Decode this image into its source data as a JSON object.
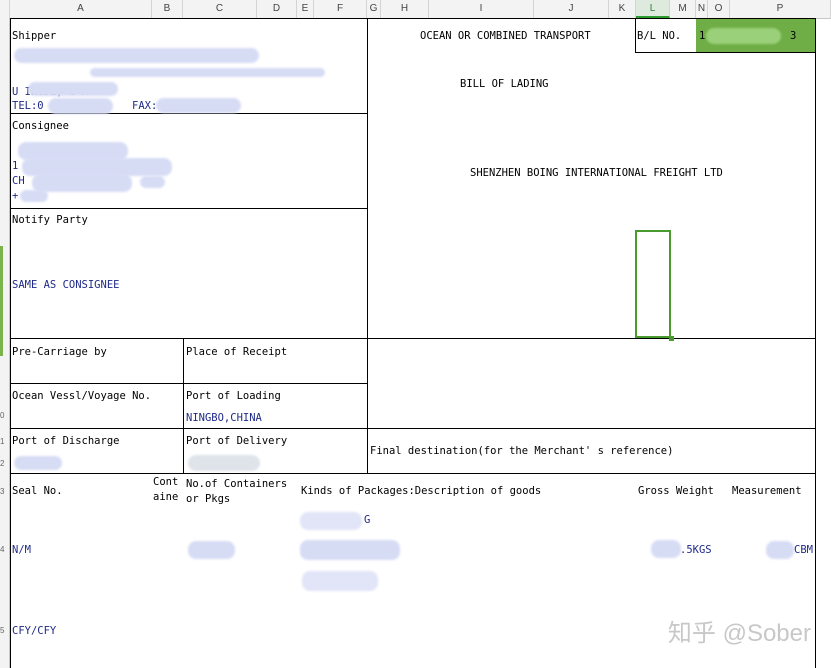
{
  "columns": [
    "A",
    "B",
    "C",
    "D",
    "E",
    "F",
    "G",
    "H",
    "I",
    "J",
    "K",
    "L",
    "M",
    "N",
    "O",
    "P"
  ],
  "selected_column": "L",
  "row_numbers": [
    "0",
    "1",
    "2",
    "3",
    "4",
    "5"
  ],
  "shipper": {
    "label": "Shipper",
    "line2": "U                      INGDE, C    A",
    "tel_label": "TEL:0",
    "fax_label": "FAX:"
  },
  "consignee": {
    "label": "Consignee",
    "line1": "1",
    "line2": "CH",
    "line3": "+"
  },
  "notify": {
    "label": "Notify Party",
    "value": "SAME AS CONSIGNEE"
  },
  "header": {
    "transport": "OCEAN OR COMBINED TRANSPORT",
    "bol_label": "B/L NO.",
    "bol_value": "1",
    "bol_suffix": "3",
    "bill": "BILL OF LADING",
    "company": "SHENZHEN BOING INTERNATIONAL FREIGHT LTD"
  },
  "pre_carriage": {
    "label": "Pre-Carriage by"
  },
  "place_receipt": {
    "label": "Place of Receipt"
  },
  "vessel": {
    "label": "Ocean Vessl/Voyage No."
  },
  "port_loading": {
    "label": "Port of Loading",
    "value": "NINGBO,CHINA"
  },
  "port_discharge": {
    "label": "Port of Discharge"
  },
  "port_delivery": {
    "label": "Port of Delivery"
  },
  "final_dest": {
    "label": "Final destination(for the Merchant' s reference)"
  },
  "goods_header": {
    "seal": "Seal No.",
    "cont1": "Cont",
    "cont2": "aine",
    "containers1": "No.of Containers",
    "containers2": "or Pkgs",
    "kinds": "Kinds of Packages:Description of goods",
    "gross": "Gross Weight",
    "measure": "Measurement"
  },
  "goods": {
    "marks": "N/M",
    "desc_suffix": "G",
    "weight_suffix": ".5KGS",
    "measure_suffix": "CBM",
    "terms": "CFY/CFY"
  },
  "watermark": "知乎 @Sober"
}
